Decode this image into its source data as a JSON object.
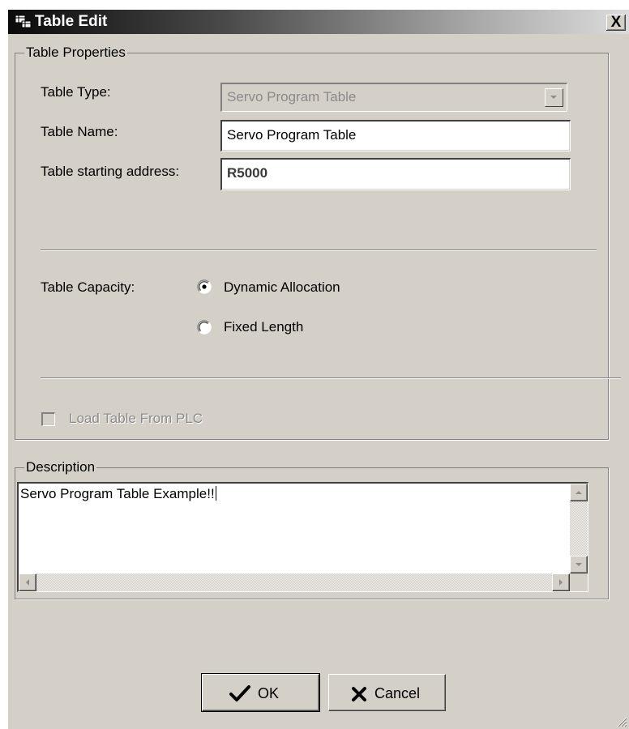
{
  "window": {
    "title": "Table Edit",
    "close_glyph": "X"
  },
  "table_properties": {
    "legend": "Table Properties",
    "table_type_label": "Table Type:",
    "table_type_value": "Servo Program Table",
    "table_name_label": "Table Name:",
    "table_name_value": "Servo Program Table",
    "start_address_label": "Table starting address:",
    "start_address_value": "R5000",
    "capacity_label": "Table Capacity:",
    "capacity_options": [
      {
        "label": "Dynamic Allocation",
        "selected": true
      },
      {
        "label": "Fixed Length",
        "selected": false
      }
    ],
    "load_from_plc_label": "Load Table From PLC",
    "load_from_plc_checked": false,
    "load_from_plc_enabled": false
  },
  "description": {
    "legend": "Description",
    "text": "Servo Program Table Example!!"
  },
  "buttons": {
    "ok_label": "OK",
    "cancel_label": "Cancel"
  },
  "icons": {
    "app": "table-app-icon",
    "ok": "checkmark-icon",
    "cancel": "x-cancel-icon"
  },
  "colors": {
    "dialog_face": "#d4d0c8",
    "title_gradient_start": "#0a0a0a",
    "title_gradient_end": "#dcdcdc",
    "disabled_text": "#8c8c8c"
  }
}
